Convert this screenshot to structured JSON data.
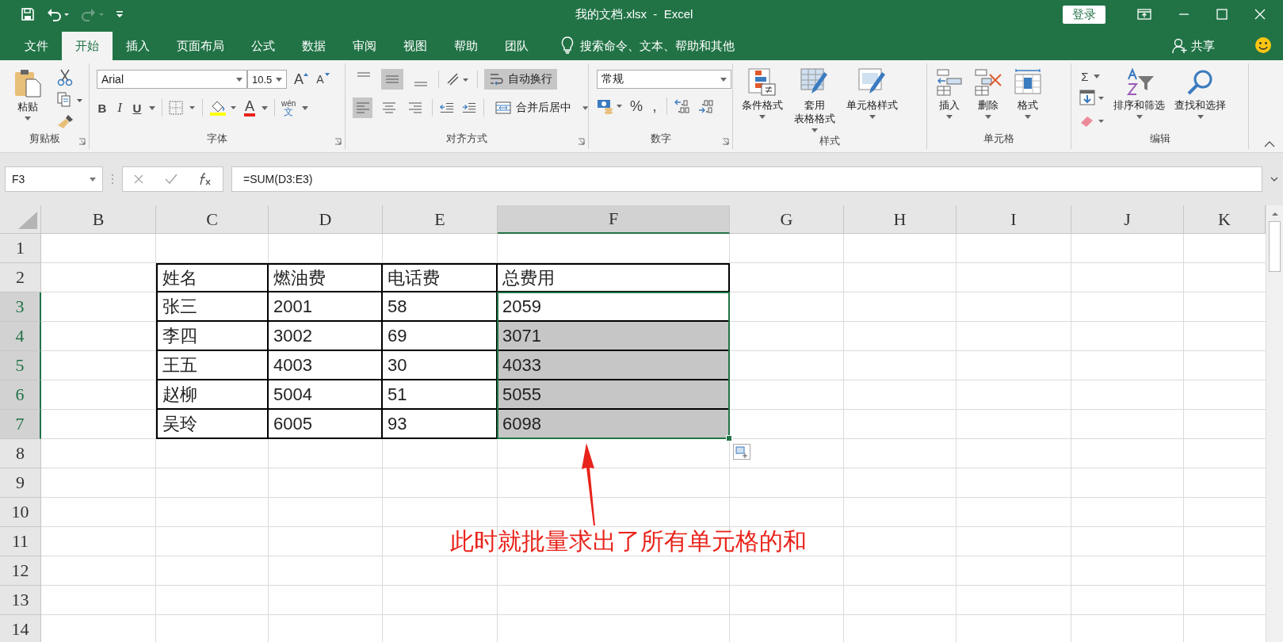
{
  "window": {
    "title": "我的文档.xlsx  -  Excel",
    "sign_in": "登录"
  },
  "tabs": [
    {
      "label": "文件",
      "selected": false
    },
    {
      "label": "开始",
      "selected": true
    },
    {
      "label": "插入",
      "selected": false
    },
    {
      "label": "页面布局",
      "selected": false
    },
    {
      "label": "公式",
      "selected": false
    },
    {
      "label": "数据",
      "selected": false
    },
    {
      "label": "审阅",
      "selected": false
    },
    {
      "label": "视图",
      "selected": false
    },
    {
      "label": "帮助",
      "selected": false
    },
    {
      "label": "团队",
      "selected": false
    }
  ],
  "tell_me": "搜索命令、文本、帮助和其他",
  "share": "共享",
  "ribbon": {
    "clipboard": {
      "paste": "粘贴",
      "label": "剪贴板"
    },
    "font": {
      "name": "Arial",
      "size": "10.5",
      "grow": "A",
      "shrink": "A",
      "bold": "B",
      "italic": "I",
      "underline": "U",
      "font_color": "A",
      "phonetic_top": "wén",
      "phonetic_bottom": "文",
      "label": "字体"
    },
    "alignment": {
      "vertical": [
        {
          "selected": false
        },
        {
          "selected": true
        },
        {
          "selected": false
        }
      ],
      "horizontal": [
        {
          "selected": true
        },
        {
          "selected": false
        },
        {
          "selected": false
        }
      ],
      "wrap_text": {
        "label": "自动换行",
        "on": true
      },
      "merge": "合并后居中",
      "label": "对齐方式"
    },
    "number": {
      "format": "常规",
      "percent": "%",
      "comma": ",",
      "label": "数字"
    },
    "styles": {
      "buttons": [
        {
          "lines": [
            "条件格式"
          ]
        },
        {
          "lines": [
            "套用",
            "表格格式"
          ]
        },
        {
          "lines": [
            "单元格样式"
          ]
        }
      ],
      "label": "样式"
    },
    "cells": {
      "buttons": [
        "插入",
        "删除",
        "格式"
      ],
      "label": "单元格"
    },
    "editing": {
      "autosum": "Σ",
      "sort": "排序和筛选",
      "find": "查找和选择",
      "label": "编辑"
    }
  },
  "formula_bar": {
    "name_box": "F3",
    "formula": "=SUM(D3:E3)"
  },
  "sheet": {
    "columns": [
      {
        "label": "B",
        "selected": false
      },
      {
        "label": "C",
        "selected": false
      },
      {
        "label": "D",
        "selected": false
      },
      {
        "label": "E",
        "selected": false
      },
      {
        "label": "F",
        "selected": true
      },
      {
        "label": "G",
        "selected": false
      },
      {
        "label": "H",
        "selected": false
      },
      {
        "label": "I",
        "selected": false
      },
      {
        "label": "J",
        "selected": false
      },
      {
        "label": "K",
        "selected": false
      }
    ],
    "rows": [
      {
        "label": "1",
        "selected": false
      },
      {
        "label": "2",
        "selected": false
      },
      {
        "label": "3",
        "selected": true
      },
      {
        "label": "4",
        "selected": true
      },
      {
        "label": "5",
        "selected": true
      },
      {
        "label": "6",
        "selected": true
      },
      {
        "label": "7",
        "selected": true
      },
      {
        "label": "8",
        "selected": false
      },
      {
        "label": "9",
        "selected": false
      },
      {
        "label": "10",
        "selected": false
      },
      {
        "label": "11",
        "selected": false
      },
      {
        "label": "12",
        "selected": false
      },
      {
        "label": "13",
        "selected": false
      },
      {
        "label": "14",
        "selected": false
      }
    ],
    "table": [
      [
        {
          "text": "姓名",
          "selected": false
        },
        {
          "text": "燃油费",
          "selected": false
        },
        {
          "text": "电话费",
          "selected": false
        },
        {
          "text": "总费用",
          "selected": false
        }
      ],
      [
        {
          "text": "张三",
          "selected": false
        },
        {
          "text": "2001",
          "selected": false
        },
        {
          "text": "58",
          "selected": false
        },
        {
          "text": "2059",
          "selected": true
        }
      ],
      [
        {
          "text": "李四",
          "selected": false
        },
        {
          "text": "3002",
          "selected": false
        },
        {
          "text": "69",
          "selected": false
        },
        {
          "text": "3071",
          "selected": true
        }
      ],
      [
        {
          "text": "王五",
          "selected": false
        },
        {
          "text": "4003",
          "selected": false
        },
        {
          "text": "30",
          "selected": false
        },
        {
          "text": "4033",
          "selected": true
        }
      ],
      [
        {
          "text": "赵柳",
          "selected": false
        },
        {
          "text": "5004",
          "selected": false
        },
        {
          "text": "51",
          "selected": false
        },
        {
          "text": "5055",
          "selected": true
        }
      ],
      [
        {
          "text": "吴玲",
          "selected": false
        },
        {
          "text": "6005",
          "selected": false
        },
        {
          "text": "93",
          "selected": false
        },
        {
          "text": "6098",
          "selected": true
        }
      ]
    ]
  },
  "annotation": "此时就批量求出了所有单元格的和"
}
